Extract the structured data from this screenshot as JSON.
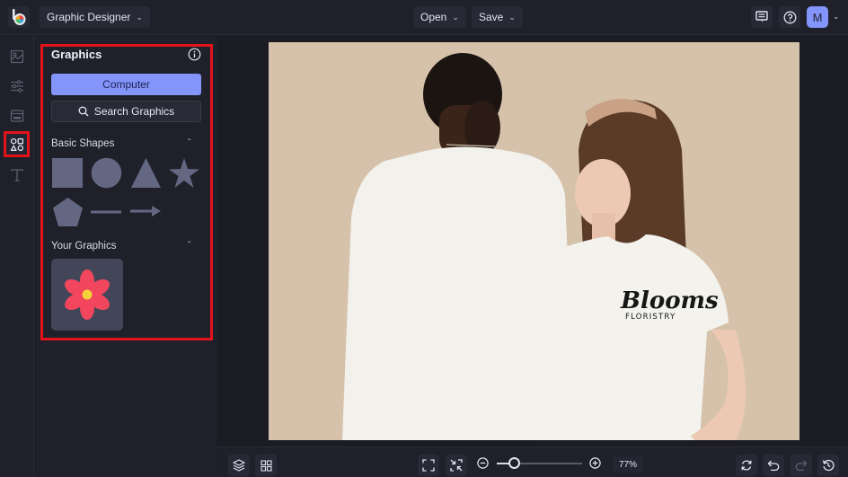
{
  "app": {
    "logo": "befunky-logo-icon",
    "mode_label": "Graphic Designer"
  },
  "topbar": {
    "open_label": "Open",
    "save_label": "Save",
    "icons": [
      "comments-icon",
      "help-icon"
    ],
    "avatar_initial": "M"
  },
  "rail": {
    "items": [
      {
        "name": "image-manager",
        "icon": "image-icon",
        "active": false
      },
      {
        "name": "edit",
        "icon": "sliders-icon",
        "active": false
      },
      {
        "name": "templates",
        "icon": "layout-icon",
        "active": false
      },
      {
        "name": "graphics",
        "icon": "shapes-icon",
        "active": true
      },
      {
        "name": "text",
        "icon": "text-icon",
        "active": false
      }
    ]
  },
  "panel": {
    "title": "Graphics",
    "computer_label": "Computer",
    "search_label": "Search Graphics",
    "basic_shapes_label": "Basic Shapes",
    "basic_shapes": [
      "square",
      "circle",
      "triangle",
      "star",
      "pentagon",
      "line",
      "arrow"
    ],
    "your_graphics_label": "Your Graphics",
    "your_graphics": [
      {
        "name": "red-flower",
        "color": "#f2465e",
        "center_color": "#f4d23a"
      }
    ]
  },
  "canvas": {
    "background_color": "#d6c2ab",
    "shirt_logo_line1": "Blooms",
    "shirt_logo_line2": "FLORISTRY"
  },
  "bottombar": {
    "zoom_percent": "77%",
    "zoom_level": 0.2
  },
  "colors": {
    "accent": "#8394fb",
    "highlight": "#e3131c",
    "shape_fill": "#646782"
  }
}
